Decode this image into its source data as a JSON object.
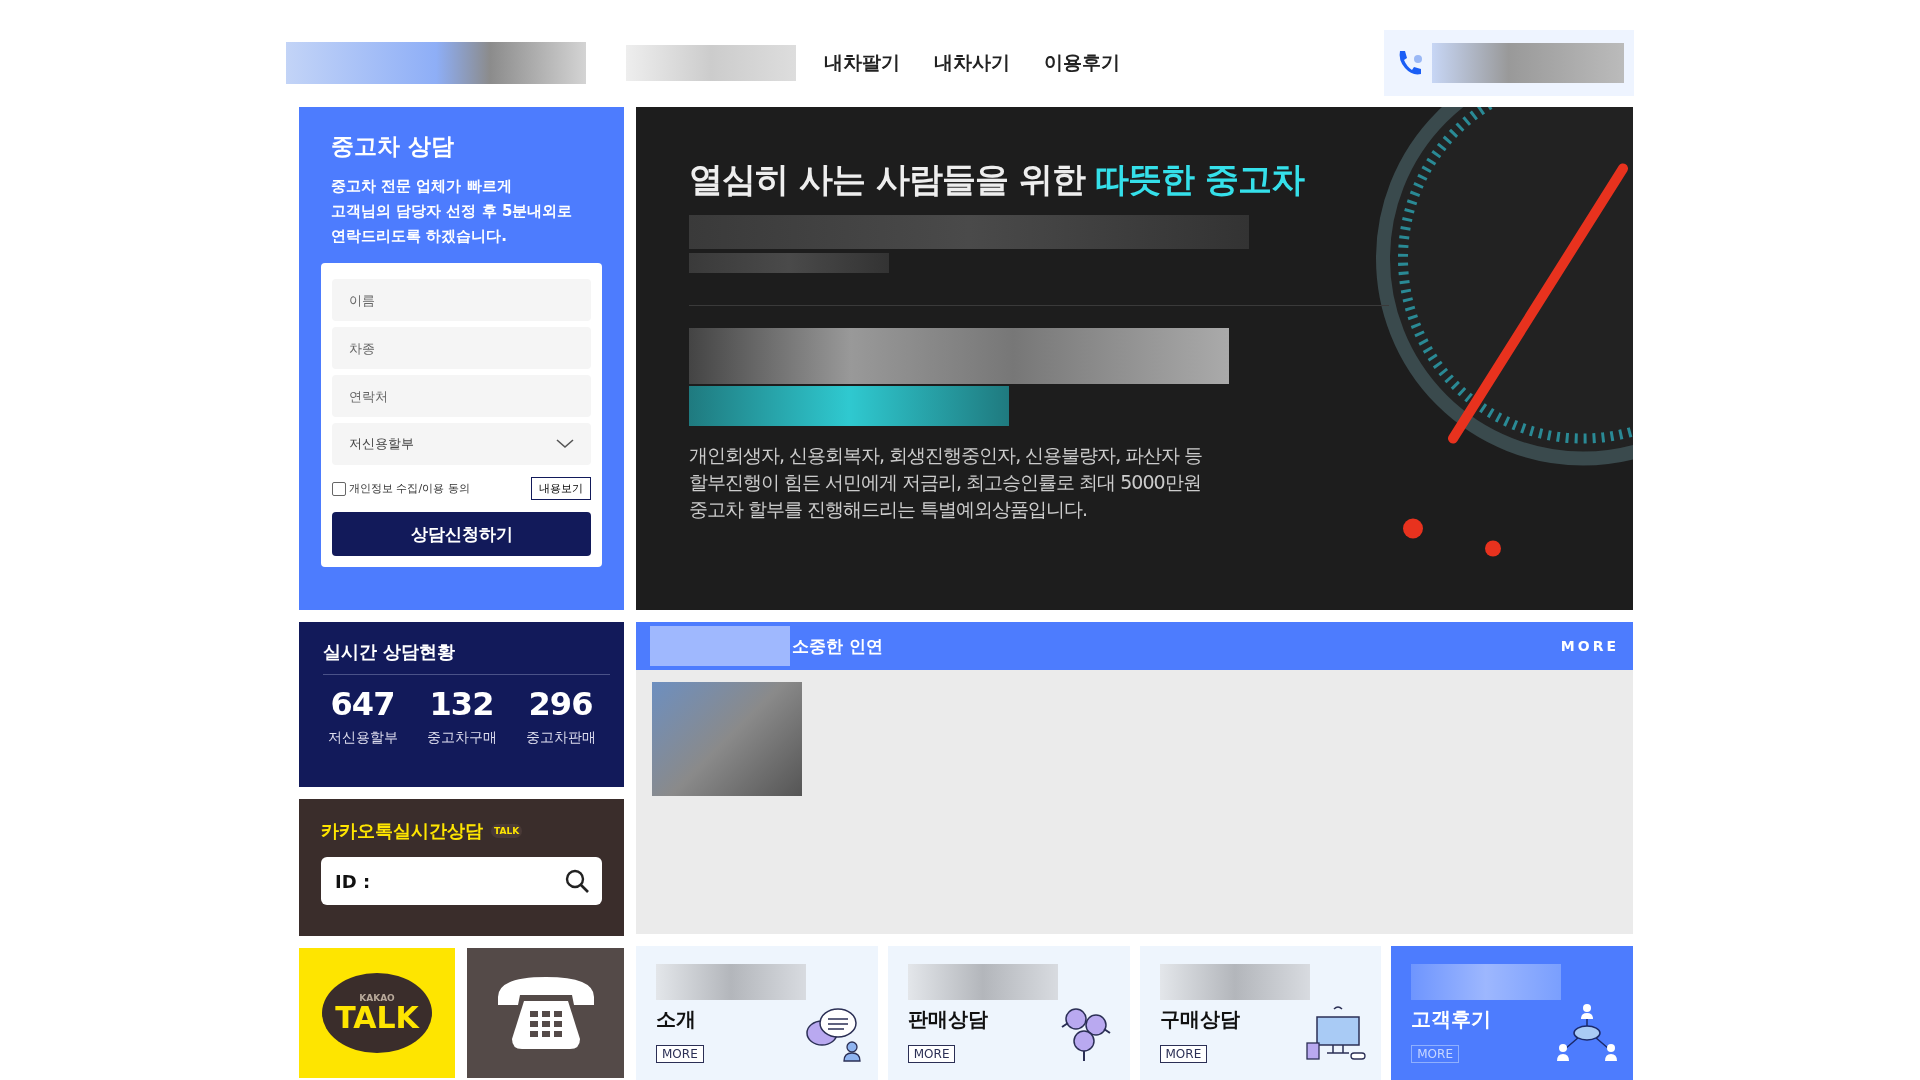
{
  "header": {
    "nav": [
      "내차팔기",
      "내차사기",
      "이용후기"
    ]
  },
  "consult": {
    "title": "중고차 상담",
    "description": "중고차 전문 업체가 빠르게\n고객님의 담당자 선정 후 5분내외로\n연락드리도록 하겠습니다.",
    "fields": [
      {
        "placeholder": "이름"
      },
      {
        "placeholder": "차종"
      },
      {
        "placeholder": "연락처"
      }
    ],
    "select": {
      "value": "저신용할부"
    },
    "agree": {
      "label": "개인정보 수집/이용 동의",
      "checked": false
    },
    "view_button": "내용보기",
    "submit": "상담신청하기"
  },
  "banner": {
    "headline": "열심히 사는 사람들을 위한 ",
    "headline_highlight": "따뜻한 중고차",
    "description": "개인회생자, 신용회복자, 회생진행중인자, 신용불량자, 파산자 등\n할부진행이 힘든 서민에게 저금리, 최고승인률로 최대 5000만원\n중고차 할부를 진행해드리는 특별예외상품입니다."
  },
  "stats": {
    "title": "실시간 상담현황",
    "items": [
      {
        "value": "647",
        "label": "저신용할부"
      },
      {
        "value": "132",
        "label": "중고차구매"
      },
      {
        "value": "296",
        "label": "중고차판매"
      }
    ]
  },
  "kakao": {
    "title": "카카오톡실시간상담",
    "badge": "TALK",
    "search": {
      "placeholder": "ID :"
    }
  },
  "kakao_tile": {
    "small": "KAKAO",
    "big": "TALK"
  },
  "gallery": {
    "title": "소중한 인연",
    "more": "MORE"
  },
  "cards": [
    {
      "title": "소개",
      "more": "MORE",
      "kind": "chat",
      "selected": false
    },
    {
      "title": "판매상담",
      "more": "MORE",
      "kind": "coins",
      "selected": false
    },
    {
      "title": "구매상담",
      "more": "MORE",
      "kind": "computer",
      "selected": false
    },
    {
      "title": "고객후기",
      "more": "MORE",
      "kind": "network",
      "selected": true
    }
  ]
}
